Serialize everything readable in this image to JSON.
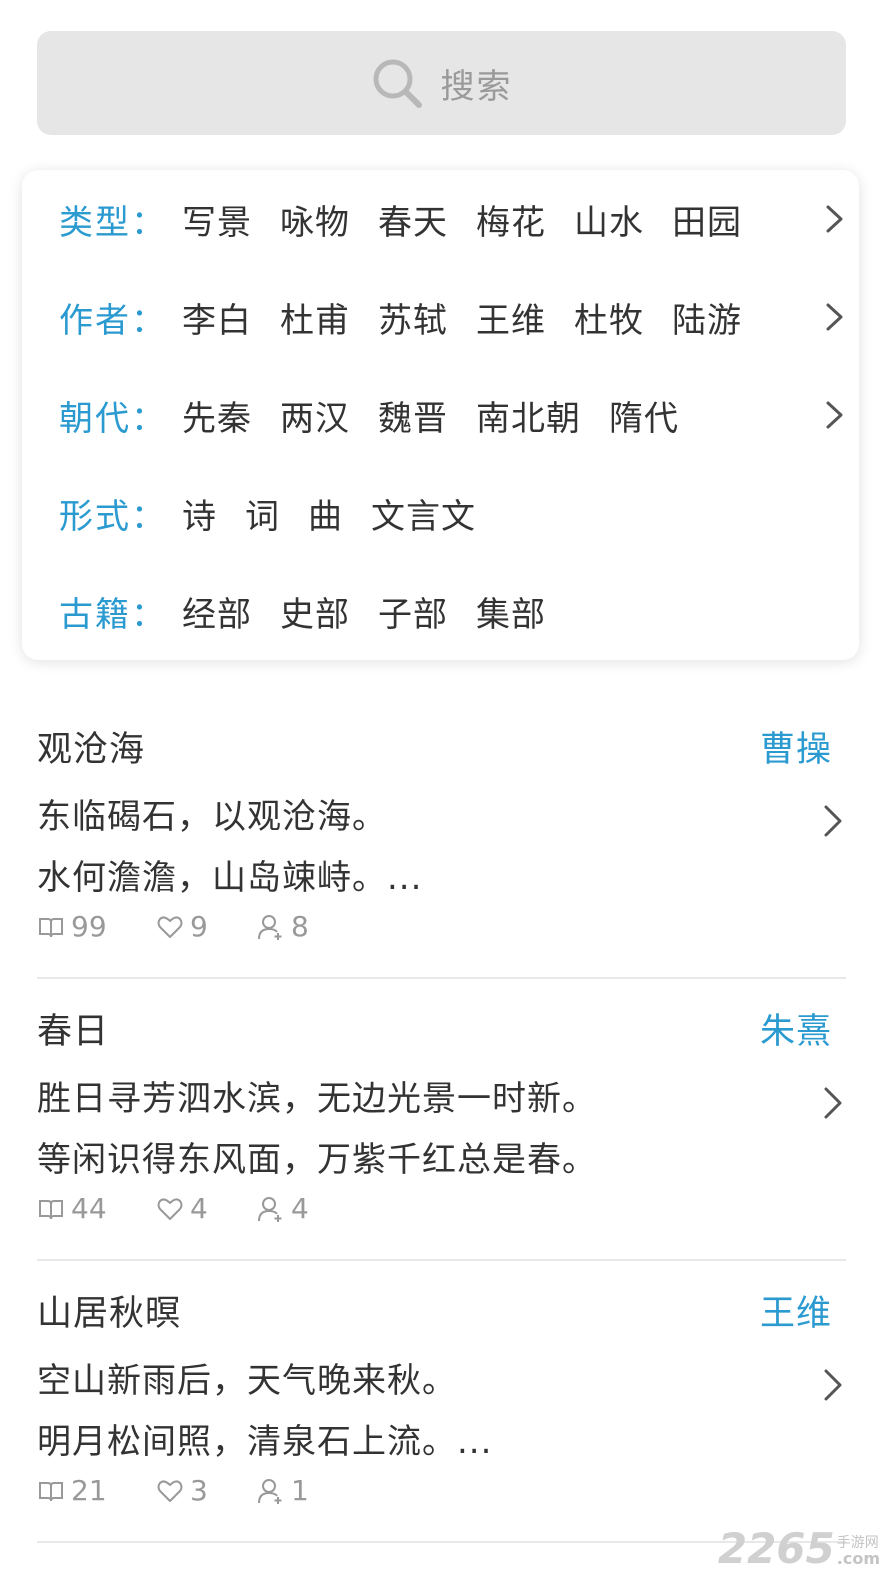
{
  "search": {
    "placeholder": "搜索"
  },
  "filters": [
    {
      "label": "类型：",
      "options": [
        "写景",
        "咏物",
        "春天",
        "梅花",
        "山水",
        "田园"
      ],
      "has_more": true
    },
    {
      "label": "作者：",
      "options": [
        "李白",
        "杜甫",
        "苏轼",
        "王维",
        "杜牧",
        "陆游"
      ],
      "has_more": true
    },
    {
      "label": "朝代：",
      "options": [
        "先秦",
        "两汉",
        "魏晋",
        "南北朝",
        "隋代"
      ],
      "has_more": true
    },
    {
      "label": "形式：",
      "options": [
        "诗",
        "词",
        "曲",
        "文言文"
      ],
      "has_more": false
    },
    {
      "label": "古籍：",
      "options": [
        "经部",
        "史部",
        "子部",
        "集部"
      ],
      "has_more": false
    }
  ],
  "poems": [
    {
      "title": "观沧海",
      "author": "曹操",
      "line1": "东临碣石，以观沧海。",
      "line2": "水何澹澹，山岛竦峙。...",
      "reads": "99",
      "likes": "9",
      "users": "8"
    },
    {
      "title": "春日",
      "author": "朱熹",
      "line1": "胜日寻芳泗水滨，无边光景一时新。",
      "line2": "等闲识得东风面，万紫千红总是春。",
      "reads": "44",
      "likes": "4",
      "users": "4"
    },
    {
      "title": "山居秋暝",
      "author": "王维",
      "line1": "空山新雨后，天气晚来秋。",
      "line2": "明月松间照，清泉石上流。...",
      "reads": "21",
      "likes": "3",
      "users": "1"
    }
  ],
  "watermark": {
    "number": "2265",
    "cn": "手游网",
    "com": ".com"
  },
  "colors": {
    "accent": "#2a9ad0",
    "text": "#333333",
    "muted": "#999999",
    "search_bg": "#e6e6e6"
  },
  "icons": {
    "search": "search-icon",
    "chevron": "chevron-right-icon",
    "reads": "book-icon",
    "likes": "heart-icon",
    "users": "user-add-icon"
  }
}
